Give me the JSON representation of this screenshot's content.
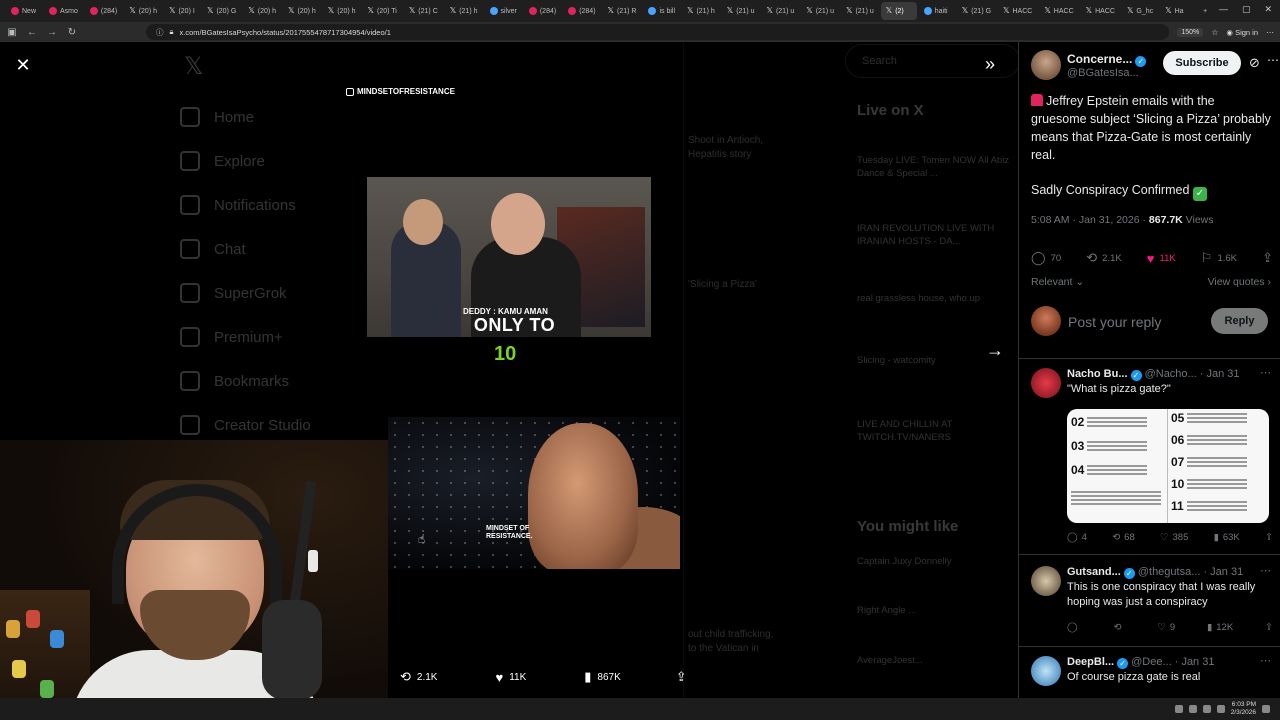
{
  "browser": {
    "tabs": [
      {
        "label": "New",
        "icon": "red"
      },
      {
        "label": "Asmo",
        "icon": "red"
      },
      {
        "label": "(284)",
        "icon": "red"
      },
      {
        "label": "(20) h",
        "icon": "x"
      },
      {
        "label": "(20) I",
        "icon": "x"
      },
      {
        "label": "(20) G",
        "icon": "x"
      },
      {
        "label": "(20) h",
        "icon": "x"
      },
      {
        "label": "(20) h",
        "icon": "x"
      },
      {
        "label": "(20) h",
        "icon": "x"
      },
      {
        "label": "(20) Ti",
        "icon": "x"
      },
      {
        "label": "(21) C",
        "icon": "x"
      },
      {
        "label": "(21) h",
        "icon": "x"
      },
      {
        "label": "silver",
        "icon": "blue"
      },
      {
        "label": "(284)",
        "icon": "red"
      },
      {
        "label": "(284)",
        "icon": "red"
      },
      {
        "label": "(21) R",
        "icon": "x"
      },
      {
        "label": "is bill",
        "icon": "blue"
      },
      {
        "label": "(21) h",
        "icon": "x"
      },
      {
        "label": "(21) u",
        "icon": "x"
      },
      {
        "label": "(21) u",
        "icon": "x"
      },
      {
        "label": "(21) u",
        "icon": "x"
      },
      {
        "label": "(21) u",
        "icon": "x"
      },
      {
        "label": "(2)",
        "icon": "x",
        "active": true
      },
      {
        "label": "haiti",
        "icon": "blue"
      },
      {
        "label": "(21) G",
        "icon": "x"
      },
      {
        "label": "HACC",
        "icon": "x"
      },
      {
        "label": "HACC",
        "icon": "x"
      },
      {
        "label": "HACC",
        "icon": "x"
      },
      {
        "label": "G_hc",
        "icon": "x"
      },
      {
        "label": "Ha",
        "icon": "x"
      }
    ],
    "url": "x.com/BGatesIsaPsycho/status/2017555478717304954/video/1",
    "zoom": "150%",
    "signin": "Sign in"
  },
  "background_page": {
    "nav": [
      "Home",
      "Explore",
      "Notifications",
      "Chat",
      "SuperGrok",
      "Premium+",
      "Bookmarks",
      "Creator Studio"
    ],
    "search": "Search",
    "live_heading": "Live on X",
    "live_items": [
      "Tuesday LIVE: Tomen NOW All Abiz Dance & Special ...",
      "IRAN REVOLUTION LIVE WITH IRANIAN HOSTS - DA...",
      "real grassless house, who up",
      "Slicing - watcomity",
      "LIVE AND CHILLIN AT TWITCH.TV/NANERS"
    ],
    "you_might_like": "You might like",
    "suggestions": [
      "Captain Juxy Donnelly",
      "Right Angle ...",
      "AverageJoest..."
    ]
  },
  "video": {
    "watermark": "MINDSETOFRESISTANCE",
    "top_caption": "DEDDY : KAMU AMAN",
    "overlay_line1": "ONLY TO",
    "overlay_line2": "10",
    "bottom_brand_line1": "MINDSET OF",
    "bottom_brand_line2": "RESISTANCE.",
    "actions": {
      "reposts": "2.1K",
      "likes": "11K",
      "views": "867K"
    }
  },
  "tweet": {
    "author_name": "Concerne...",
    "author_handle": "@BGatesIsa...",
    "subscribe_label": "Subscribe",
    "text_line1": "Jeffrey Epstein emails with the gruesome subject ‘Slicing a Pizza’ probably means that Pizza-Gate is most certainly real.",
    "text_line2": "Sadly Conspiracy Confirmed",
    "time": "5:08 AM · Jan 31, 2026 · ",
    "views_count": "867.7K",
    "views_label": " Views",
    "stats": {
      "replies": "70",
      "reposts": "2.1K",
      "likes": "11K",
      "bookmarks": "1.6K"
    },
    "sort_label": "Relevant",
    "view_quotes": "View quotes",
    "reply_placeholder": "Post your reply",
    "reply_button": "Reply"
  },
  "replies": [
    {
      "name": "Nacho Bu...",
      "handle": "@Nacho...",
      "date": "· Jan 31",
      "text": "\"What is pizza gate?\"",
      "stats": {
        "replies": "4",
        "reposts": "68",
        "likes": "385",
        "views": "63K"
      },
      "infographic_numbers": [
        "02",
        "03",
        "04",
        "05",
        "06",
        "07",
        "10",
        "11"
      ]
    },
    {
      "name": "Gutsand...",
      "handle": "@thegutsa...",
      "date": "· Jan 31",
      "text": "This is one conspiracy that I was really hoping was just a conspiracy",
      "stats": {
        "replies": "",
        "reposts": "",
        "likes": "9",
        "views": "12K"
      }
    },
    {
      "name": "DeepBl...",
      "handle": "@Dee...",
      "date": "· Jan 31",
      "text": "Of course pizza gate is real"
    }
  ],
  "taskbar": {
    "time": "6:03 PM",
    "date": "2/3/2026"
  },
  "colors": {
    "accent_blue": "#1d9bf0",
    "like_pink": "#f91880",
    "overlay_green": "#7dd321"
  }
}
